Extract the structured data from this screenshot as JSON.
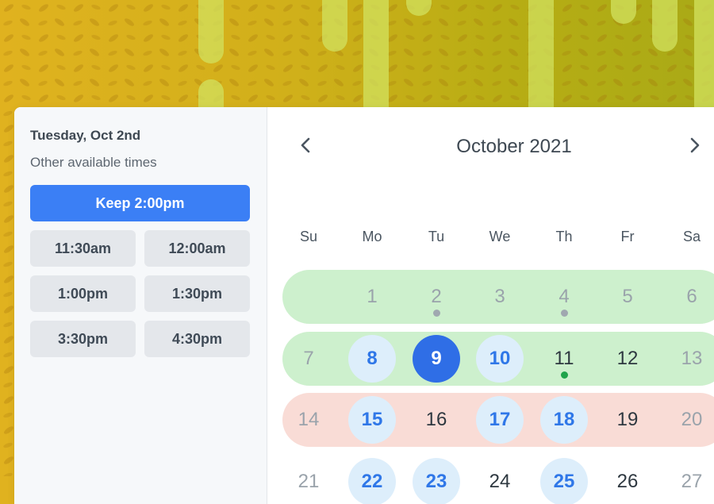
{
  "scheduler": {
    "date_heading": "Tuesday, Oct 2nd",
    "available_label": "Other available times",
    "keep_button": "Keep 2:00pm",
    "time_slots": [
      "11:30am",
      "12:00am",
      "1:00pm",
      "1:30pm",
      "3:30pm",
      "4:30pm"
    ]
  },
  "calendar": {
    "month_title": "October 2021",
    "prev_icon": "chevron-left-icon",
    "next_icon": "chevron-right-icon",
    "weekdays": [
      "Su",
      "Mo",
      "Tu",
      "We",
      "Th",
      "Fr",
      "Sa"
    ],
    "weeks": [
      {
        "band": "green",
        "days": [
          {
            "label": "",
            "state": "empty"
          },
          {
            "label": "1",
            "state": "muted"
          },
          {
            "label": "2",
            "state": "muted",
            "dot": "gray"
          },
          {
            "label": "3",
            "state": "muted"
          },
          {
            "label": "4",
            "state": "muted",
            "dot": "gray"
          },
          {
            "label": "5",
            "state": "muted"
          },
          {
            "label": "6",
            "state": "muted"
          }
        ]
      },
      {
        "band": "green",
        "days": [
          {
            "label": "7",
            "state": "muted"
          },
          {
            "label": "8",
            "state": "available"
          },
          {
            "label": "9",
            "state": "selected"
          },
          {
            "label": "10",
            "state": "available"
          },
          {
            "label": "11",
            "state": "dark",
            "dot": "green"
          },
          {
            "label": "12",
            "state": "dark"
          },
          {
            "label": "13",
            "state": "muted"
          }
        ]
      },
      {
        "band": "red",
        "days": [
          {
            "label": "14",
            "state": "muted"
          },
          {
            "label": "15",
            "state": "available"
          },
          {
            "label": "16",
            "state": "dark"
          },
          {
            "label": "17",
            "state": "available"
          },
          {
            "label": "18",
            "state": "available"
          },
          {
            "label": "19",
            "state": "dark"
          },
          {
            "label": "20",
            "state": "muted"
          }
        ]
      },
      {
        "band": "none",
        "days": [
          {
            "label": "21",
            "state": "muted"
          },
          {
            "label": "22",
            "state": "available"
          },
          {
            "label": "23",
            "state": "available"
          },
          {
            "label": "24",
            "state": "dark"
          },
          {
            "label": "25",
            "state": "available"
          },
          {
            "label": "26",
            "state": "dark"
          },
          {
            "label": "27",
            "state": "muted"
          }
        ]
      }
    ]
  },
  "colors": {
    "primary": "#3b7ff5",
    "selected_day": "#2f6ee6",
    "available_day_bg": "#ddeefb",
    "band_green": "#cdf0cd",
    "band_red": "#f9dcd6",
    "dot_gray": "#a0a8b0",
    "dot_green": "#1fa34a"
  }
}
